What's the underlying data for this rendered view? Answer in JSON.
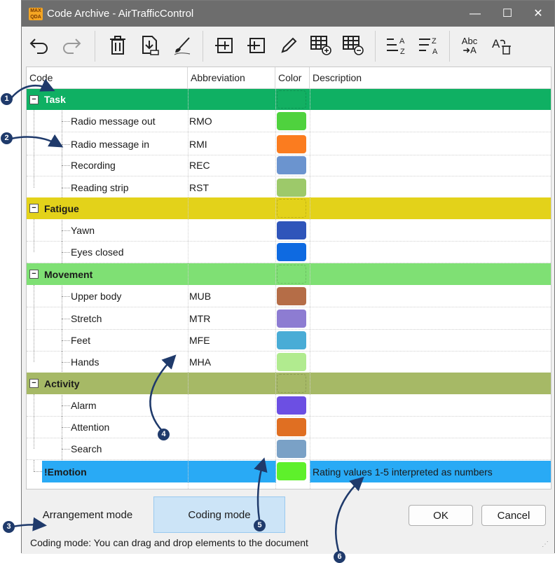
{
  "window": {
    "app_icon": "MAXQDA",
    "title": "Code Archive - AirTrafficControl",
    "minimize": "—",
    "maximize": "☐",
    "close": "✕"
  },
  "toolbar": {
    "undo": "undo-icon",
    "redo": "redo-icon",
    "delete": "trash-icon",
    "import": "import-icon",
    "clean": "brush-icon",
    "add_code": "add-code-icon",
    "add_subcode": "add-subcode-icon",
    "edit": "pencil-icon",
    "add_table": "table-add-icon",
    "remove_table": "table-remove-icon",
    "sort_az": "sort-az-icon",
    "sort_za": "sort-za-icon",
    "abc_rename": "Abc",
    "delete_text": "delete-text-icon"
  },
  "columns": {
    "code": "Code",
    "abbreviation": "Abbreviation",
    "color": "Color",
    "description": "Description"
  },
  "groups": [
    {
      "name": "Task",
      "bg": "#0fb063",
      "text_color": "#ffffff",
      "swatch": "#12b062",
      "children": [
        {
          "name": "Radio message out",
          "abbr": "RMO",
          "color": "#4fd23e"
        },
        {
          "name": "Radio message in",
          "abbr": "RMI",
          "color": "#fb7c1f"
        },
        {
          "name": "Recording",
          "abbr": "REC",
          "color": "#6b94cf"
        },
        {
          "name": "Reading strip",
          "abbr": "RST",
          "color": "#9dc96a"
        }
      ]
    },
    {
      "name": "Fatigue",
      "bg": "#e3d21a",
      "text_color": "#1a1a1a",
      "swatch": "#e3d21a",
      "children": [
        {
          "name": "Yawn",
          "abbr": "",
          "color": "#2f55ba"
        },
        {
          "name": "Eyes closed",
          "abbr": "",
          "color": "#0e6ae1"
        }
      ]
    },
    {
      "name": "Movement",
      "bg": "#7fe074",
      "text_color": "#1a1a1a",
      "swatch": "#7fe074",
      "children": [
        {
          "name": "Upper body",
          "abbr": "MUB",
          "color": "#b56d47"
        },
        {
          "name": "Stretch",
          "abbr": "MTR",
          "color": "#8d7cd2"
        },
        {
          "name": "Feet",
          "abbr": "MFE",
          "color": "#49acd6"
        },
        {
          "name": "Hands",
          "abbr": "MHA",
          "color": "#b1eb8f"
        }
      ]
    },
    {
      "name": "Activity",
      "bg": "#a6b966",
      "text_color": "#1a1a1a",
      "swatch": "#a6b966",
      "children": [
        {
          "name": "Alarm",
          "abbr": "",
          "color": "#6c4fe3"
        },
        {
          "name": "Attention",
          "abbr": "",
          "color": "#e06f22"
        },
        {
          "name": "Search",
          "abbr": "",
          "color": "#7aa1c6"
        }
      ]
    }
  ],
  "emotion": {
    "name": "!Emotion",
    "bg": "#29aaf5",
    "color": "#5ef02b",
    "description": "Rating values 1-5 interpreted as numbers"
  },
  "bottom": {
    "arrangement_mode": "Arrangement mode",
    "coding_mode": "Coding mode",
    "ok": "OK",
    "cancel": "Cancel",
    "status": "Coding mode: You can drag and drop elements to the document"
  },
  "callouts": [
    "1",
    "2",
    "3",
    "4",
    "5",
    "6"
  ]
}
